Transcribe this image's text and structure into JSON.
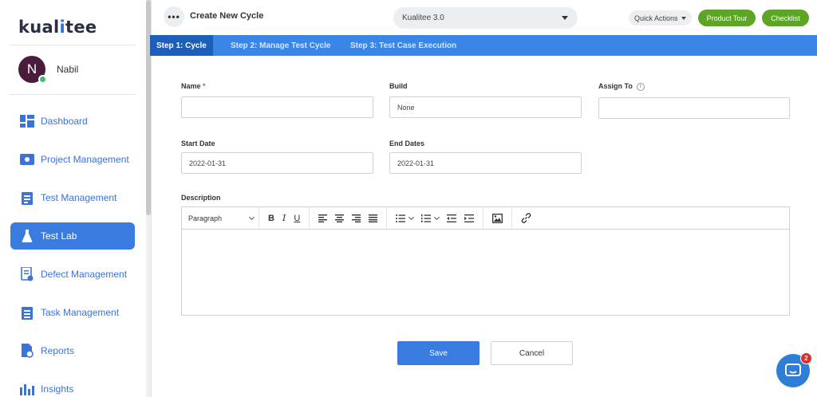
{
  "brand": {
    "logo_left": "kual",
    "logo_i": "i",
    "logo_right": "tee"
  },
  "user": {
    "initial": "N",
    "name": "Nabil"
  },
  "sidebar": {
    "items": [
      {
        "label": "Dashboard",
        "icon": "dashboard-icon"
      },
      {
        "label": "Project Management",
        "icon": "project-icon"
      },
      {
        "label": "Test Management",
        "icon": "test-management-icon"
      },
      {
        "label": "Test Lab",
        "icon": "flask-icon",
        "active": true
      },
      {
        "label": "Defect Management",
        "icon": "defect-icon"
      },
      {
        "label": "Task Management",
        "icon": "task-icon"
      },
      {
        "label": "Reports",
        "icon": "reports-icon"
      },
      {
        "label": "Insights",
        "icon": "insights-icon"
      }
    ]
  },
  "header": {
    "title": "Create New Cycle",
    "more_label": "•••",
    "project_select": "Kualitee 3.0",
    "quick_actions": "Quick Actions",
    "product_tour": "Product Tour",
    "checklist": "Checklist"
  },
  "steps": [
    {
      "label": "Step 1: Cycle",
      "active": true
    },
    {
      "label": "Step 2: Manage Test Cycle"
    },
    {
      "label": "Step 3: Test Case Execution"
    }
  ],
  "form": {
    "name_label": "Name",
    "required_mark": "*",
    "name_value": "",
    "build_label": "Build",
    "build_value": "None",
    "assign_label": "Assign To",
    "assign_info": "i",
    "assign_value": "",
    "start_label": "Start Date",
    "start_value": "2022-01-31",
    "end_label": "End Dates",
    "end_value": "2022-01-31",
    "description_label": "Description",
    "paragraph": "Paragraph"
  },
  "buttons": {
    "save": "Save",
    "cancel": "Cancel"
  },
  "chat": {
    "badge": "2"
  },
  "colors": {
    "primary": "#3a7be0",
    "tab_bar": "#3a86e6",
    "green": "#5ca526",
    "badge": "#d9302c"
  }
}
